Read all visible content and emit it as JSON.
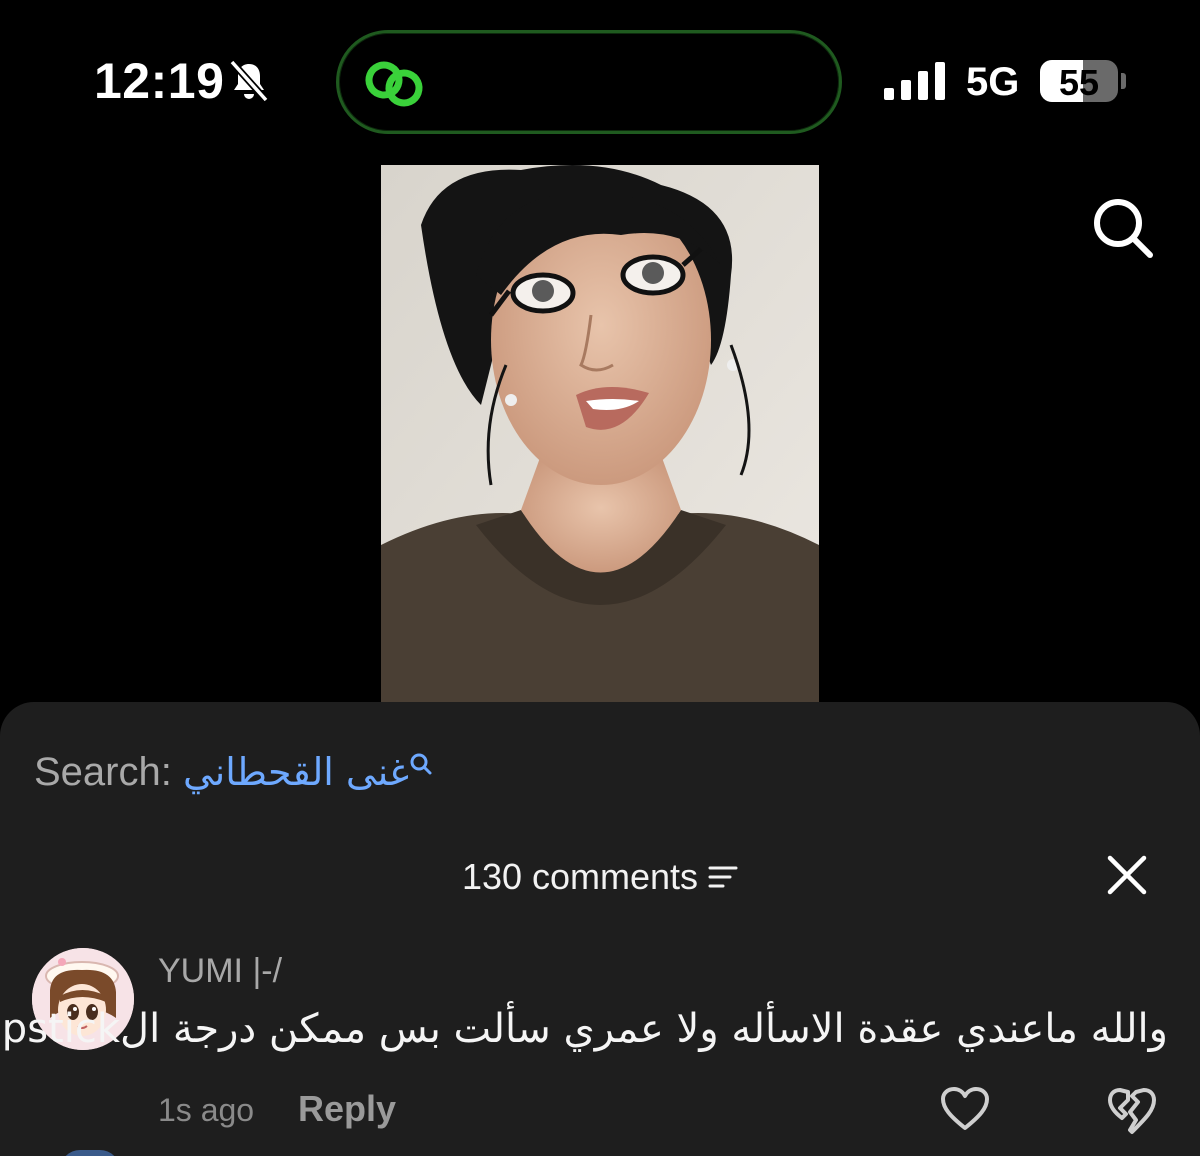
{
  "status_bar": {
    "time": "12:19",
    "network": "5G",
    "battery_percent": 55,
    "battery_label": "55",
    "icons": [
      "bell-slash-icon",
      "linked-rings-icon",
      "signal-icon",
      "battery-icon"
    ],
    "island_accent": "#3ad13a"
  },
  "video": {
    "description_icons": [
      "search-icon"
    ]
  },
  "sheet": {
    "search_prefix": "Search: ",
    "search_term": "غنى القحطاني",
    "search_term_color": "#6ea9ff",
    "comments_count_label": "130 comments",
    "comment": {
      "username": "YUMI |-/",
      "text": "والله ماعندي عقدة الاسأله ولا عمري سألت بس ممكن درجة الlipstick",
      "timestamp": "1s ago",
      "reply_label": "Reply"
    }
  },
  "colors": {
    "background": "#000000",
    "sheet": "#1e1e1e",
    "muted_text": "#a8a8a8"
  }
}
